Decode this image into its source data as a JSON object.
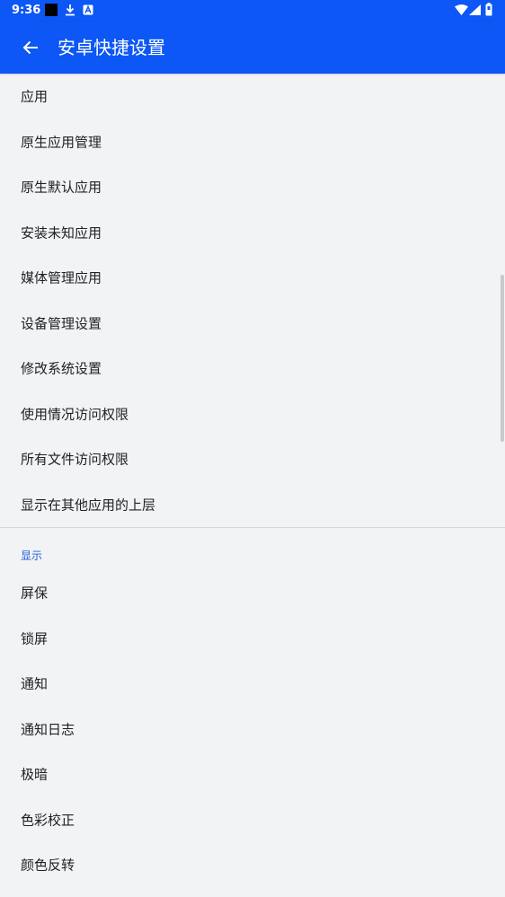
{
  "status_bar": {
    "time": "9:36",
    "icons": [
      "black-square-icon",
      "download-icon",
      "a-box-icon",
      "wifi-icon",
      "signal-icon",
      "battery-icon"
    ]
  },
  "app_bar": {
    "title": "安卓快捷设置",
    "back_icon": "arrow-back-icon"
  },
  "colors": {
    "accent": "#0c57f5",
    "background": "#f1f3f5",
    "section_header": "#1a5fd8",
    "text": "#202124"
  },
  "apps_section": {
    "items": [
      "应用",
      "原生应用管理",
      "原生默认应用",
      "安装未知应用",
      "媒体管理应用",
      "设备管理设置",
      "修改系统设置",
      "使用情况访问权限",
      "所有文件访问权限",
      "显示在其他应用的上层"
    ]
  },
  "display_section": {
    "header": "显示",
    "items": [
      "屏保",
      "锁屏",
      "通知",
      "通知日志",
      "极暗",
      "色彩校正",
      "颜色反转"
    ]
  }
}
